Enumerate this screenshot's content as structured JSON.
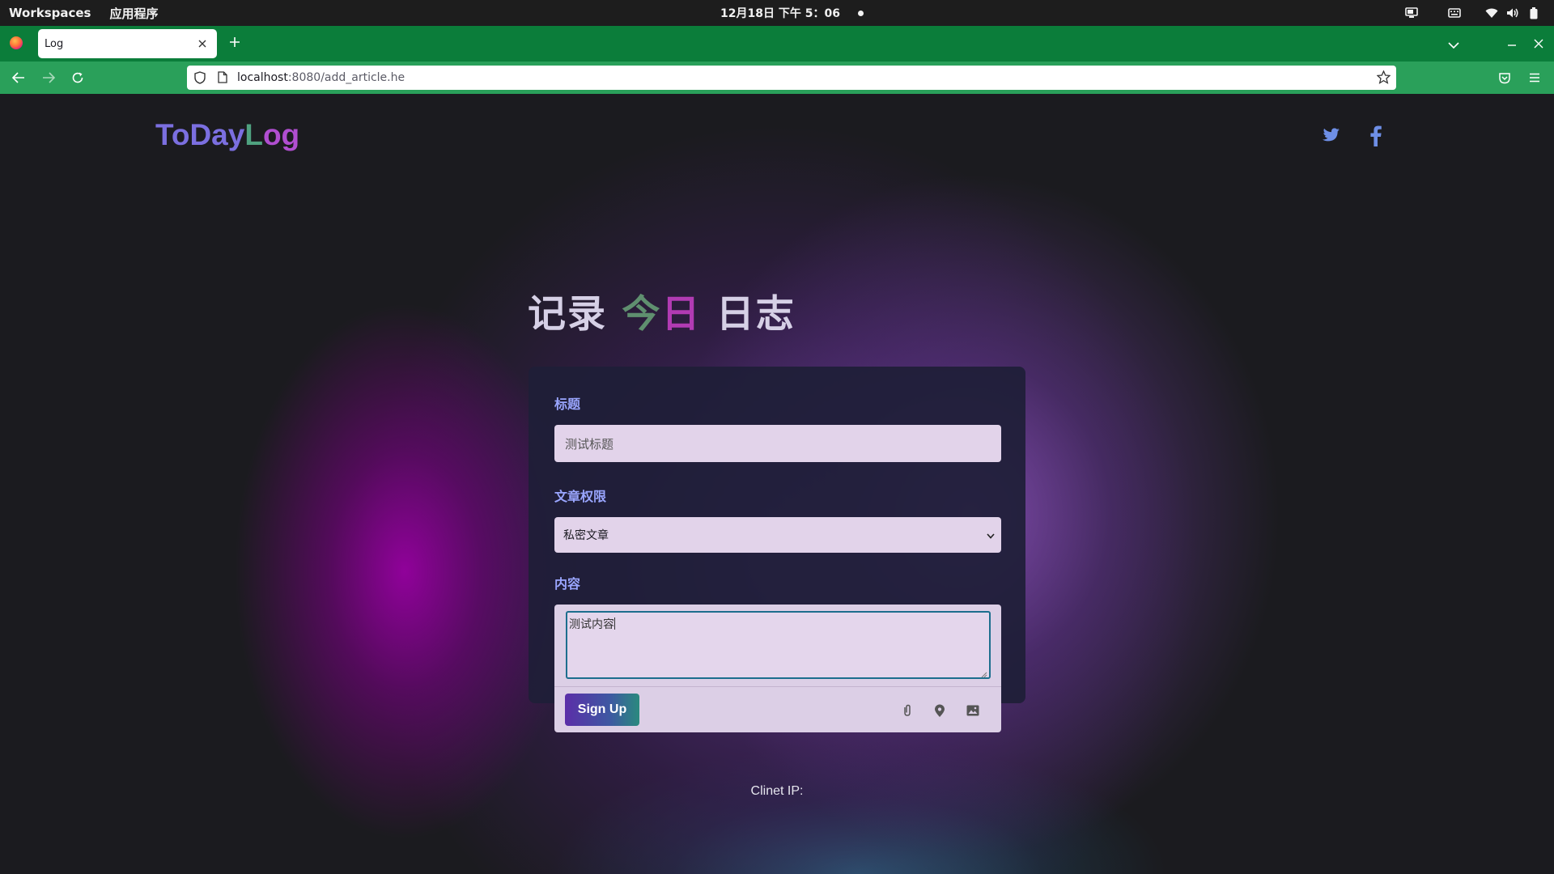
{
  "system_bar": {
    "activities": "Workspaces",
    "apps_menu": "应用程序",
    "clock": "12月18日 下午 5：06"
  },
  "browser": {
    "tab": {
      "title": "Log"
    },
    "url": {
      "host": "localhost",
      "path": ":8080/add_article.he"
    },
    "accent": "#0b7d3a"
  },
  "site": {
    "brand": {
      "part1": "ToDay",
      "part2": "L",
      "part3": "og"
    },
    "social": [
      "twitter-icon",
      "facebook-icon"
    ]
  },
  "form": {
    "heading": {
      "prefix": "记录 ",
      "highlight1": "今",
      "highlight2": "日",
      "suffix": " 日志"
    },
    "title_label": "标题",
    "title_value": "测试标题",
    "permission_label": "文章权限",
    "permission_selected": "私密文章",
    "content_label": "内容",
    "content_value": "测试内容",
    "submit_label": "Sign Up",
    "toolbar_icons": [
      "attach-icon",
      "location-icon",
      "image-icon"
    ]
  },
  "footer": {
    "client_ip": "Clinet IP:"
  }
}
